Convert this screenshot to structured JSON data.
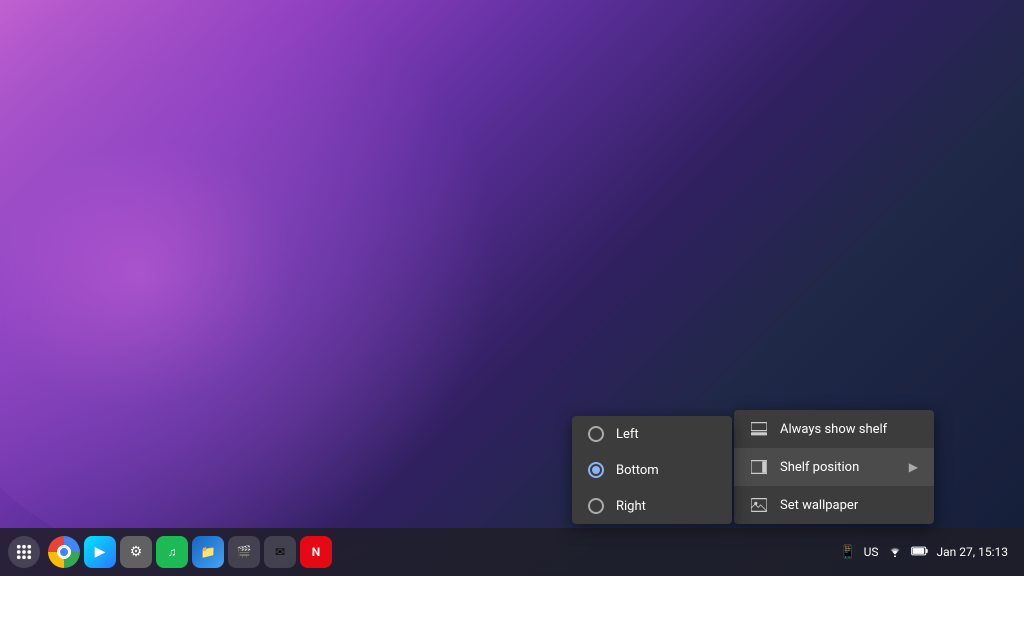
{
  "wallpaper": {
    "description": "ChromeOS abstract swirl wallpaper"
  },
  "taskbar": {
    "launcher_icon": "⊙",
    "apps": [
      {
        "name": "Chrome",
        "icon": "🌐",
        "color": "#4285f4"
      },
      {
        "name": "Play Store",
        "icon": "▶",
        "color": "#00bcd4"
      },
      {
        "name": "Settings",
        "icon": "⚙",
        "color": "#757575"
      },
      {
        "name": "Spotify",
        "icon": "♪",
        "color": "#1db954"
      },
      {
        "name": "Files",
        "icon": "📁",
        "color": "#1565c0"
      }
    ],
    "extra_apps": [
      "🎬",
      "📧",
      "🔴"
    ]
  },
  "status_area": {
    "sim_icon": "📱",
    "data_label": "US",
    "wifi_icon": "wifi",
    "battery_icon": "battery",
    "clock": "Jan 27, 15:13"
  },
  "context_menu": {
    "items": [
      {
        "id": "always-show-shelf",
        "label": "Always show shelf",
        "icon": "shelf",
        "has_submenu": false
      },
      {
        "id": "shelf-position",
        "label": "Shelf position",
        "icon": "position",
        "has_submenu": true
      },
      {
        "id": "set-wallpaper",
        "label": "Set wallpaper",
        "icon": "wallpaper",
        "has_submenu": false
      }
    ]
  },
  "submenu": {
    "title": "Shelf position",
    "items": [
      {
        "id": "left",
        "label": "Left",
        "selected": false
      },
      {
        "id": "bottom",
        "label": "Bottom",
        "selected": true
      },
      {
        "id": "right",
        "label": "Right",
        "selected": false
      }
    ]
  }
}
